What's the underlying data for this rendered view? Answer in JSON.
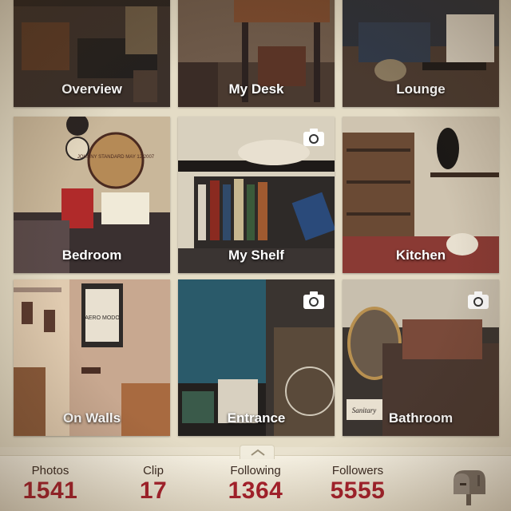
{
  "albums": [
    {
      "label": "Overview",
      "camera": false
    },
    {
      "label": "My Desk",
      "camera": false
    },
    {
      "label": "Lounge",
      "camera": false
    },
    {
      "label": "Bedroom",
      "camera": false
    },
    {
      "label": "My Shelf",
      "camera": true,
      "camera_icon": "camera-icon"
    },
    {
      "label": "Kitchen",
      "camera": false
    },
    {
      "label": "On Walls",
      "camera": false
    },
    {
      "label": "Entrance",
      "camera": true,
      "camera_icon": "camera-icon"
    },
    {
      "label": "Bathroom",
      "camera": true,
      "camera_icon": "camera-icon"
    }
  ],
  "photo_text": {
    "clock": "JOHNNY STANDARD MAY 12 2007",
    "poster": "AERO MODO",
    "sanitary": "Sanitary"
  },
  "stats": [
    {
      "label": "Photos",
      "value": "1541"
    },
    {
      "label": "Clip",
      "value": "17"
    },
    {
      "label": "Following",
      "value": "1364"
    },
    {
      "label": "Followers",
      "value": "5555"
    }
  ],
  "icons": {
    "drawer_handle": "chevron-up-icon",
    "mailbox": "mailbox-icon"
  },
  "colors": {
    "accent": "#a8202c",
    "background": "#e9e2cf"
  }
}
